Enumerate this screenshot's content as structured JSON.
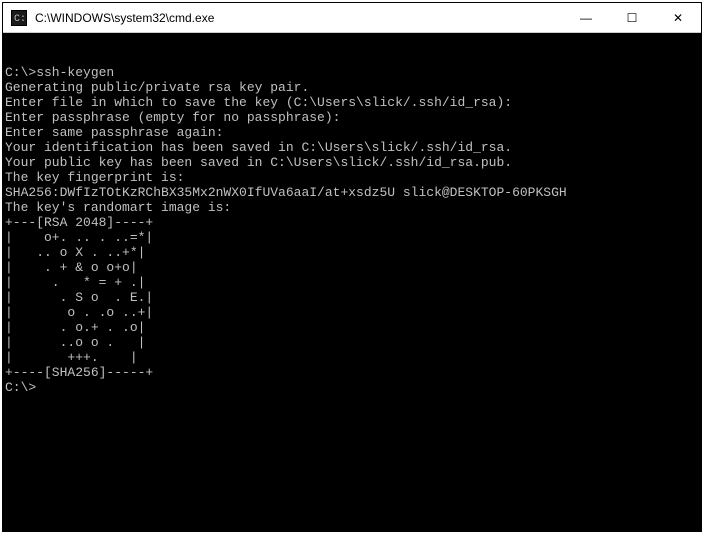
{
  "titlebar": {
    "icon_name": "cmd-icon",
    "title": "C:\\WINDOWS\\system32\\cmd.exe"
  },
  "controls": {
    "minimize": "—",
    "maximize": "☐",
    "close": "✕"
  },
  "terminal": {
    "lines": [
      "C:\\>ssh-keygen",
      "Generating public/private rsa key pair.",
      "Enter file in which to save the key (C:\\Users\\slick/.ssh/id_rsa):",
      "Enter passphrase (empty for no passphrase):",
      "Enter same passphrase again:",
      "Your identification has been saved in C:\\Users\\slick/.ssh/id_rsa.",
      "Your public key has been saved in C:\\Users\\slick/.ssh/id_rsa.pub.",
      "The key fingerprint is:",
      "SHA256:DWfIzTOtKzRChBX35Mx2nWX0IfUVa6aaI/at+xsdz5U slick@DESKTOP-60PKSGH",
      "The key's randomart image is:",
      "+---[RSA 2048]----+",
      "|    o+. .. . ..=*|",
      "|   .. o X . ..+*|",
      "|    . + & o o+o|",
      "|     .   * = + .|",
      "|      . S o  . E.|",
      "|       o . .o ..+|",
      "|      . o.+ . .o|",
      "|      ..o o .   |",
      "|       +++.    |",
      "+----[SHA256]-----+",
      "",
      "C:\\>"
    ]
  }
}
